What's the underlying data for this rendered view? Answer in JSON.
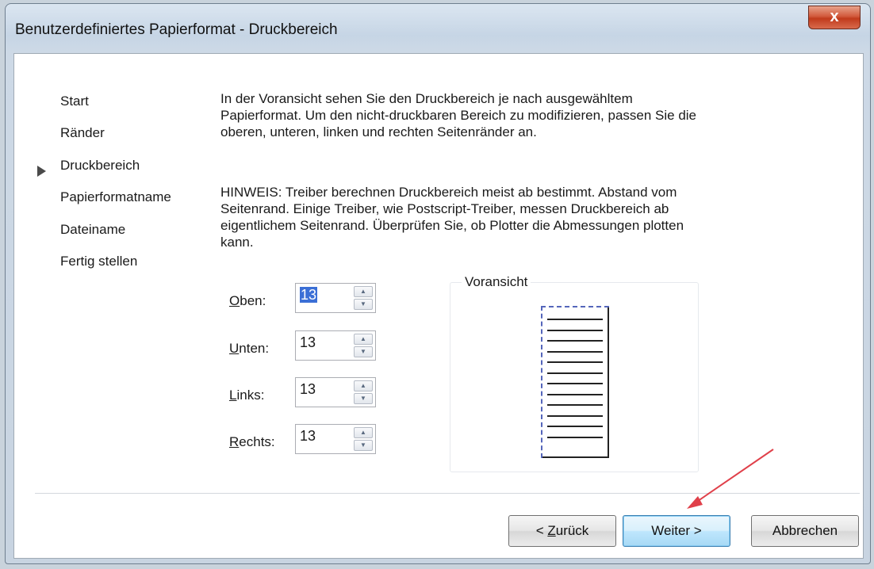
{
  "window": {
    "title": "Benutzerdefiniertes Papierformat - Druckbereich",
    "close_label": "x"
  },
  "steps": [
    {
      "label": "Start",
      "current": false
    },
    {
      "label": "Ränder",
      "current": false
    },
    {
      "label": "Druckbereich",
      "current": true
    },
    {
      "label": "Papierformatname",
      "current": false
    },
    {
      "label": "Dateiname",
      "current": false
    },
    {
      "label": "Fertig stellen",
      "current": false
    }
  ],
  "main": {
    "intro": "In der Voransicht sehen Sie den Druckbereich je nach ausgewähltem Papierformat. Um den nicht-druckbaren Bereich zu modifizieren, passen Sie die oberen, unteren, linken und rechten Seitenränder an.",
    "note": "HINWEIS: Treiber berechnen Druckbereich meist ab bestimmt. Abstand vom Seitenrand. Einige Treiber, wie Postscript-Treiber, messen Druckbereich ab eigentlichem Seitenrand. Überprüfen Sie, ob Plotter die Abmessungen plotten kann."
  },
  "fields": {
    "top": {
      "label_access": "O",
      "label_rest": "ben:",
      "value": "13"
    },
    "bottom": {
      "label_access": "U",
      "label_rest": "nten:",
      "value": "13"
    },
    "left": {
      "label_access": "L",
      "label_rest": "inks:",
      "value": "13"
    },
    "right": {
      "label_access": "R",
      "label_rest": "echts:",
      "value": "13"
    }
  },
  "preview": {
    "label": "Voransicht",
    "line_count": 12
  },
  "buttons": {
    "back_prefix": "< ",
    "back_access": "Z",
    "back_rest": "urück",
    "next": "Weiter >",
    "cancel": "Abbrechen"
  },
  "colors": {
    "annotation_arrow": "#e0404a",
    "primary_button_border": "#3c7fb1",
    "preview_dash": "#5566bb"
  }
}
